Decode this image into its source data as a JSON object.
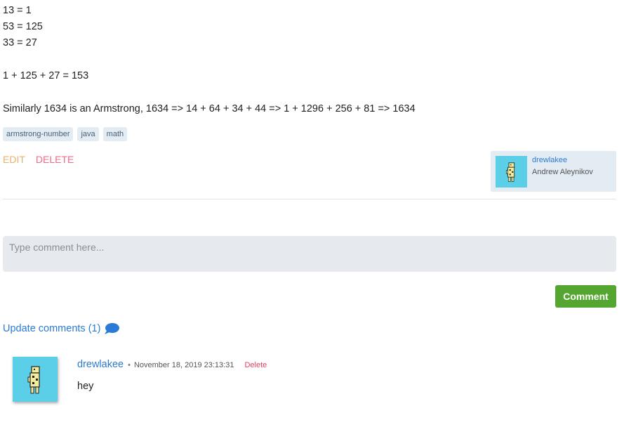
{
  "post": {
    "lines": [
      "13 = 1",
      "53 = 125",
      "33 = 27",
      "1 + 125 + 27 = 153",
      "Similarly 1634 is an Armstrong, 1634 => 14 + 64 + 34 + 44 => 1 + 1296 + 256 + 81 => 1634"
    ],
    "tags": [
      "armstrong-number",
      "java",
      "math"
    ],
    "edit_label": "EDIT",
    "delete_label": "DELETE"
  },
  "author": {
    "username": "drewlakee",
    "full_name": "Andrew Aleynikov"
  },
  "comment_form": {
    "placeholder": "Type comment here...",
    "submit_label": "Comment"
  },
  "comments_section": {
    "update_label": "Update comments (1)",
    "items": [
      {
        "username": "drewlakee",
        "separator": "•",
        "date": "November 18, 2019 23:13:31",
        "delete_label": "Delete",
        "text": "hey"
      }
    ]
  },
  "colors": {
    "accent": "#2a7bd6",
    "comment_button": "#55a531",
    "edit": "#e8b06a",
    "delete": "#f06a8a",
    "avatar_bg": "#5bcfe8"
  }
}
